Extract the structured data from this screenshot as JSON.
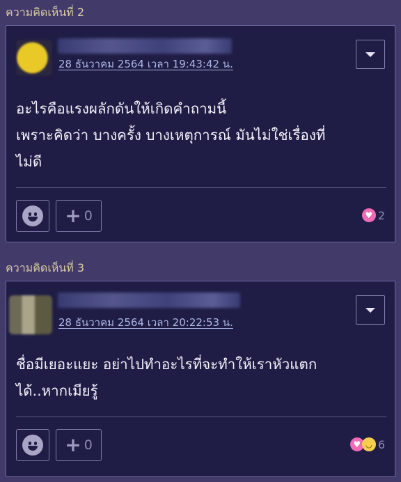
{
  "comments": [
    {
      "label": "ความคิดเห็นที่ 2",
      "timestamp": "28 ธันวาคม 2564 เวลา 19:43:42 น.",
      "lines": [
        "อะไรคือแรงผลักดันให้เกิดคำถามนี้",
        "เพราะคิดว่า บางครั้ง บางเหตุการณ์ มันไม่ใช่เรื่องที่",
        "ไม่ดี"
      ],
      "plus_count": "0",
      "reaction_count": "2",
      "reaction_icons": [
        "heart-eyes-emoji-icon"
      ]
    },
    {
      "label": "ความคิดเห็นที่ 3",
      "timestamp": "28 ธันวาคม 2564 เวลา 20:22:53 น.",
      "lines": [
        "ชื่อมีเยอะแยะ อย่าไปทำอะไรที่จะทำให้เราหัวแตก",
        "ได้..หากเมียรู้"
      ],
      "plus_count": "0",
      "reaction_count": "6",
      "reaction_icons": [
        "heart-eyes-emoji-icon",
        "laughing-emoji-icon"
      ]
    }
  ],
  "colors": {
    "page_bg": "#423b6a",
    "card_bg": "#1f1c45",
    "label": "#d9c9a6",
    "timestamp": "#aeb8e6"
  }
}
